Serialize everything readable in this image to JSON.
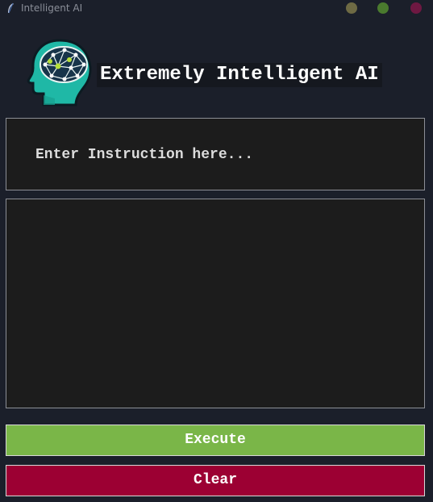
{
  "window": {
    "title": "Intelligent AI",
    "controls": {
      "minimize_color": "#6e6a44",
      "maximize_color": "#4a7a2e",
      "close_color": "#6e1842"
    }
  },
  "header": {
    "logo_icon": "brain-network-head-icon",
    "title": "Extremely Intelligent AI"
  },
  "instruction": {
    "placeholder": "Enter Instruction here...",
    "value": ""
  },
  "output": {
    "value": ""
  },
  "buttons": {
    "execute_label": "Execute",
    "clear_label": "Clear"
  },
  "colors": {
    "background": "#1b1f2a",
    "field_background": "#1c1c1c",
    "execute": "#7ab648",
    "clear": "#9c0033",
    "logo_teal": "#1fb8a6"
  }
}
